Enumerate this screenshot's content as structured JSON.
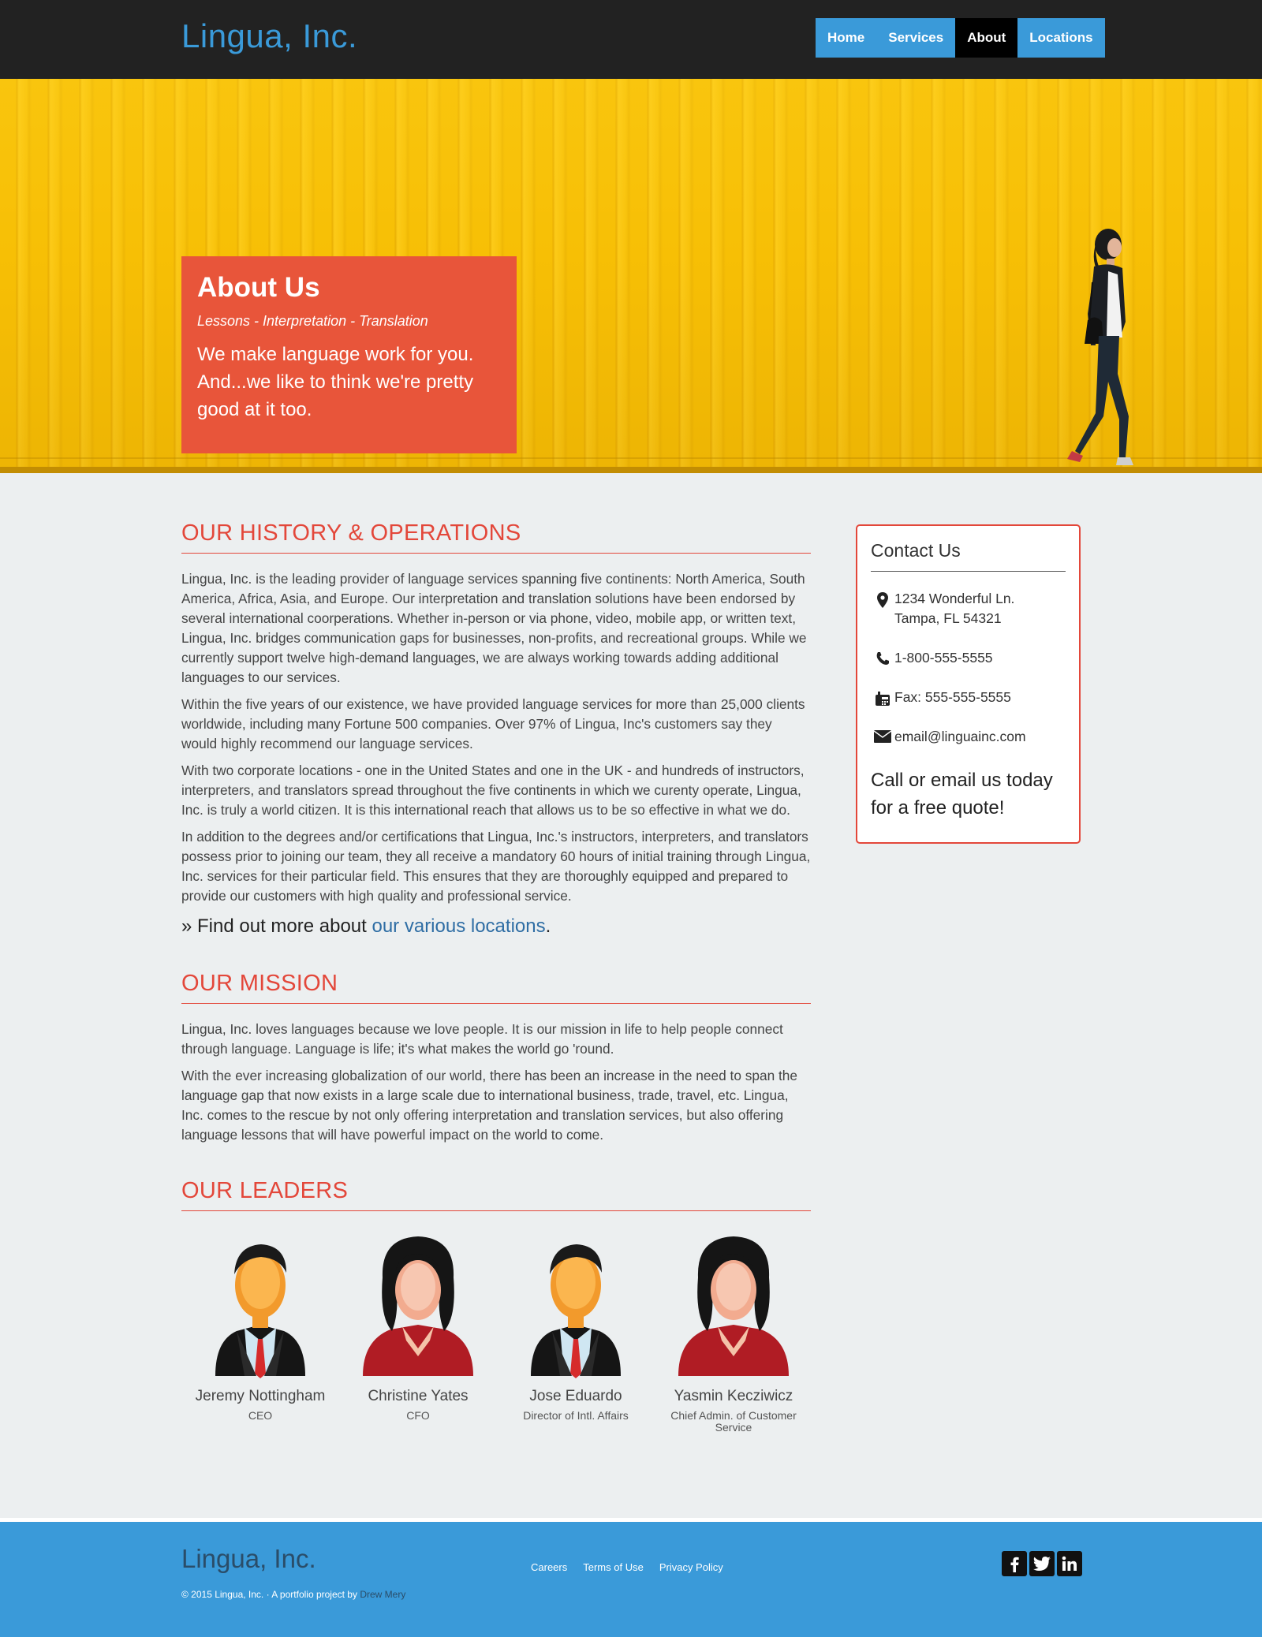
{
  "header": {
    "brand": "Lingua, Inc.",
    "nav": [
      {
        "label": "Home",
        "active": false
      },
      {
        "label": "Services",
        "active": false
      },
      {
        "label": "About",
        "active": true
      },
      {
        "label": "Locations",
        "active": false
      }
    ]
  },
  "hero": {
    "title": "About Us",
    "tagline": "Lessons - Interpretation - Translation",
    "lead": "We make language work for you. And...we like to think we're pretty good at it too."
  },
  "history": {
    "title": "OUR HISTORY & OPERATIONS",
    "paragraphs": [
      "Lingua, Inc. is the leading provider of language services spanning five continents: North America, South America, Africa, Asia, and Europe. Our interpretation and translation solutions have been endorsed by several international coorperations. Whether in-person or via phone, video, mobile app, or written text, Lingua, Inc. bridges communication gaps for businesses, non-profits, and recreational groups. While we currently support twelve high-demand languages, we are always working towards adding additional languages to our services.",
      "Within the five years of our existence, we have provided language services for more than 25,000 clients worldwide, including many Fortune 500 companies. Over 97% of Lingua, Inc's customers say they would highly recommend our language services.",
      "With two corporate locations - one in the United States and one in the UK - and hundreds of instructors, interpreters, and translators spread throughout the five continents in which we curenty operate, Lingua, Inc. is truly a world citizen. It is this international reach that allows us to be so effective in what we do.",
      "In addition to the degrees and/or certifications that Lingua, Inc.'s instructors, interpreters, and translators possess prior to joining our team, they all receive a mandatory 60 hours of initial training through Lingua, Inc. services for their particular field. This ensures that they are thoroughly equipped and prepared to provide our customers with high quality and professional service."
    ],
    "find_prefix": "» Find out more about ",
    "find_link": "our various locations",
    "find_suffix": "."
  },
  "mission": {
    "title": "OUR MISSION",
    "paragraphs": [
      "Lingua, Inc. loves languages because we love people. It is our mission in life to help people connect through language. Language is life; it's what makes the world go 'round.",
      "With the ever increasing globalization of our world, there has been an increase in the need to span the language gap that now exists in a large scale due to international business, trade, travel, etc. Lingua, Inc. comes to the rescue by not only offering interpretation and translation services, but also offering language lessons that will have powerful impact on the world to come."
    ]
  },
  "leaders": {
    "title": "OUR LEADERS",
    "people": [
      {
        "name": "Jeremy Nottingham",
        "role": "CEO",
        "avatar": "businessman-icon"
      },
      {
        "name": "Christine Yates",
        "role": "CFO",
        "avatar": "businesswoman-icon"
      },
      {
        "name": "Jose Eduardo",
        "role": "Director of Intl. Affairs",
        "avatar": "businessman-icon"
      },
      {
        "name": "Yasmin Kecziwicz",
        "role": "Chief Admin. of Customer Service",
        "avatar": "businesswoman-icon"
      }
    ]
  },
  "contact": {
    "title": "Contact Us",
    "address_line1": "1234 Wonderful Ln.",
    "address_line2": "Tampa, FL 54321",
    "phone": "1-800-555-5555",
    "fax": "Fax: 555-555-5555",
    "email": "email@linguainc.com",
    "cta": "Call or email us today for a free quote!",
    "icons": [
      "map-marker-icon",
      "phone-icon",
      "fax-icon",
      "envelope-icon"
    ]
  },
  "footer": {
    "brand": "Lingua, Inc.",
    "links": [
      "Careers",
      "Terms of Use",
      "Privacy Policy"
    ],
    "copyright": "© 2015 Lingua, Inc. · A portfolio project by ",
    "author": "Drew Mery",
    "social": [
      "facebook-icon",
      "twitter-icon",
      "linkedin-icon"
    ]
  },
  "colors": {
    "brand_blue": "#3a9ad9",
    "accent_red": "#e3473a",
    "hero_box": "#e8553a",
    "hero_yellow": "#f7bf05",
    "header_dark": "#222222"
  }
}
